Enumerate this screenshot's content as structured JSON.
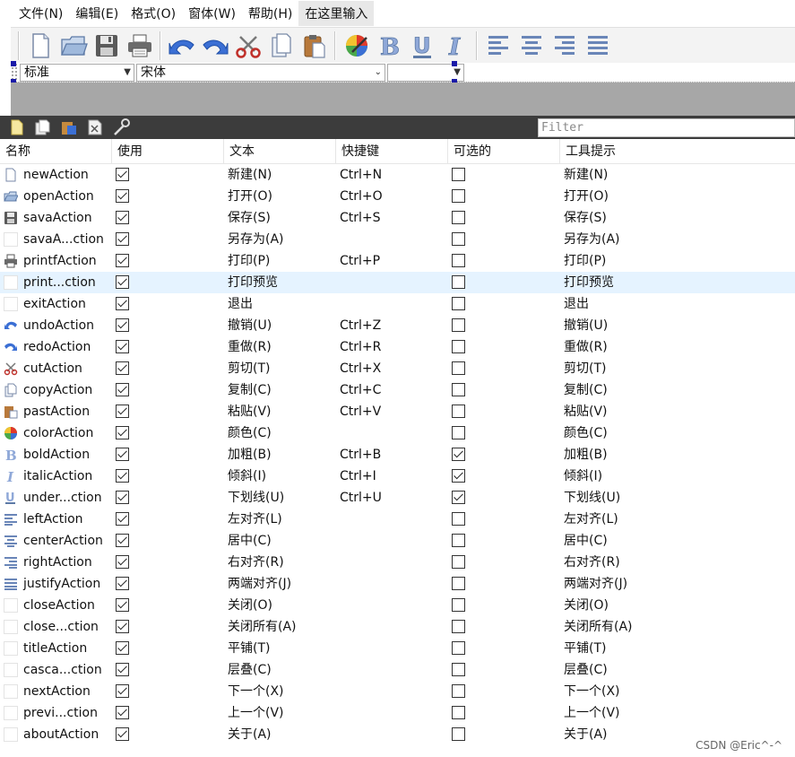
{
  "menubar": {
    "items": [
      "文件(N)",
      "编辑(E)",
      "格式(O)",
      "窗体(W)",
      "帮助(H)",
      "在这里输入"
    ]
  },
  "toolbar": {
    "buttons": [
      "new-icon",
      "open-icon",
      "save-icon",
      "print-icon",
      "undo-icon",
      "redo-icon",
      "cut-icon",
      "copy-icon",
      "paste-icon",
      "color-icon",
      "bold-icon",
      "underline-icon",
      "italic-icon",
      "align-left-icon",
      "align-center-icon",
      "align-right-icon",
      "justify-icon"
    ]
  },
  "formatbar": {
    "style_value": "标准",
    "font_value": "宋体",
    "size_value": ""
  },
  "action_editor": {
    "filter_placeholder": "Filter",
    "buttons": [
      "new-action-icon",
      "copy-action-icon",
      "paste-action-icon",
      "delete-action-icon",
      "configure-icon"
    ]
  },
  "table": {
    "headers": {
      "name": "名称",
      "used": "使用",
      "text": "文本",
      "shortcut": "快捷键",
      "checkable": "可选的",
      "tooltip": "工具提示"
    },
    "rows": [
      {
        "icon": "new-icon",
        "name": "newAction",
        "used": true,
        "text": "新建(N)",
        "shortcut": "Ctrl+N",
        "checkable": false,
        "tooltip": "新建(N)"
      },
      {
        "icon": "open-icon",
        "name": "openAction",
        "used": true,
        "text": "打开(O)",
        "shortcut": "Ctrl+O",
        "checkable": false,
        "tooltip": "打开(O)"
      },
      {
        "icon": "save-icon",
        "name": "savaAction",
        "used": true,
        "text": "保存(S)",
        "shortcut": "Ctrl+S",
        "checkable": false,
        "tooltip": "保存(S)"
      },
      {
        "icon": "none",
        "name": "savaA...ction",
        "used": true,
        "text": "另存为(A)",
        "shortcut": "",
        "checkable": false,
        "tooltip": "另存为(A)"
      },
      {
        "icon": "print-icon",
        "name": "printfAction",
        "used": true,
        "text": "打印(P)",
        "shortcut": "Ctrl+P",
        "checkable": false,
        "tooltip": "打印(P)"
      },
      {
        "icon": "none",
        "name": "print...ction",
        "used": true,
        "text": "打印预览",
        "shortcut": "",
        "checkable": false,
        "tooltip": "打印预览",
        "selected": true
      },
      {
        "icon": "none",
        "name": "exitAction",
        "used": true,
        "text": "退出",
        "shortcut": "",
        "checkable": false,
        "tooltip": "退出"
      },
      {
        "icon": "undo-icon",
        "name": "undoAction",
        "used": true,
        "text": "撤销(U)",
        "shortcut": "Ctrl+Z",
        "checkable": false,
        "tooltip": "撤销(U)"
      },
      {
        "icon": "redo-icon",
        "name": "redoAction",
        "used": true,
        "text": "重做(R)",
        "shortcut": "Ctrl+R",
        "checkable": false,
        "tooltip": "重做(R)"
      },
      {
        "icon": "cut-icon",
        "name": "cutAction",
        "used": true,
        "text": "剪切(T)",
        "shortcut": "Ctrl+X",
        "checkable": false,
        "tooltip": "剪切(T)"
      },
      {
        "icon": "copy-icon",
        "name": "copyAction",
        "used": true,
        "text": "复制(C)",
        "shortcut": "Ctrl+C",
        "checkable": false,
        "tooltip": "复制(C)"
      },
      {
        "icon": "paste-icon",
        "name": "pastAction",
        "used": true,
        "text": "粘贴(V)",
        "shortcut": "Ctrl+V",
        "checkable": false,
        "tooltip": "粘贴(V)"
      },
      {
        "icon": "color-icon",
        "name": "colorAction",
        "used": true,
        "text": "颜色(C)",
        "shortcut": "",
        "checkable": false,
        "tooltip": "颜色(C)"
      },
      {
        "icon": "bold-icon",
        "name": "boldAction",
        "used": true,
        "text": "加粗(B)",
        "shortcut": "Ctrl+B",
        "checkable": true,
        "tooltip": "加粗(B)"
      },
      {
        "icon": "italic-icon",
        "name": "italicAction",
        "used": true,
        "text": "倾斜(I)",
        "shortcut": "Ctrl+I",
        "checkable": true,
        "tooltip": "倾斜(I)"
      },
      {
        "icon": "underline-icon",
        "name": "under...ction",
        "used": true,
        "text": "下划线(U)",
        "shortcut": "Ctrl+U",
        "checkable": true,
        "tooltip": "下划线(U)"
      },
      {
        "icon": "align-left-icon",
        "name": "leftAction",
        "used": true,
        "text": "左对齐(L)",
        "shortcut": "",
        "checkable": false,
        "tooltip": "左对齐(L)"
      },
      {
        "icon": "align-center-icon",
        "name": "centerAction",
        "used": true,
        "text": "居中(C)",
        "shortcut": "",
        "checkable": false,
        "tooltip": "居中(C)"
      },
      {
        "icon": "align-right-icon",
        "name": "rightAction",
        "used": true,
        "text": "右对齐(R)",
        "shortcut": "",
        "checkable": false,
        "tooltip": "右对齐(R)"
      },
      {
        "icon": "justify-icon",
        "name": "justifyAction",
        "used": true,
        "text": "两端对齐(J)",
        "shortcut": "",
        "checkable": false,
        "tooltip": "两端对齐(J)"
      },
      {
        "icon": "none",
        "name": "closeAction",
        "used": true,
        "text": "关闭(O)",
        "shortcut": "",
        "checkable": false,
        "tooltip": "关闭(O)"
      },
      {
        "icon": "none",
        "name": "close...ction",
        "used": true,
        "text": "关闭所有(A)",
        "shortcut": "",
        "checkable": false,
        "tooltip": "关闭所有(A)"
      },
      {
        "icon": "none",
        "name": "titleAction",
        "used": true,
        "text": "平铺(T)",
        "shortcut": "",
        "checkable": false,
        "tooltip": "平铺(T)"
      },
      {
        "icon": "none",
        "name": "casca...ction",
        "used": true,
        "text": "层叠(C)",
        "shortcut": "",
        "checkable": false,
        "tooltip": "层叠(C)"
      },
      {
        "icon": "none",
        "name": "nextAction",
        "used": true,
        "text": "下一个(X)",
        "shortcut": "",
        "checkable": false,
        "tooltip": "下一个(X)"
      },
      {
        "icon": "none",
        "name": "previ...ction",
        "used": true,
        "text": "上一个(V)",
        "shortcut": "",
        "checkable": false,
        "tooltip": "上一个(V)"
      },
      {
        "icon": "none",
        "name": "aboutAction",
        "used": true,
        "text": "关于(A)",
        "shortcut": "",
        "checkable": false,
        "tooltip": "关于(A)"
      }
    ]
  },
  "watermark": "CSDN @Eric^-^",
  "colors": {
    "accent_blue": "#2f6fd0",
    "selected_row": "#e5f3ff",
    "editor_toolbar": "#3c3c3c",
    "workspace": "#a7a7a7"
  }
}
